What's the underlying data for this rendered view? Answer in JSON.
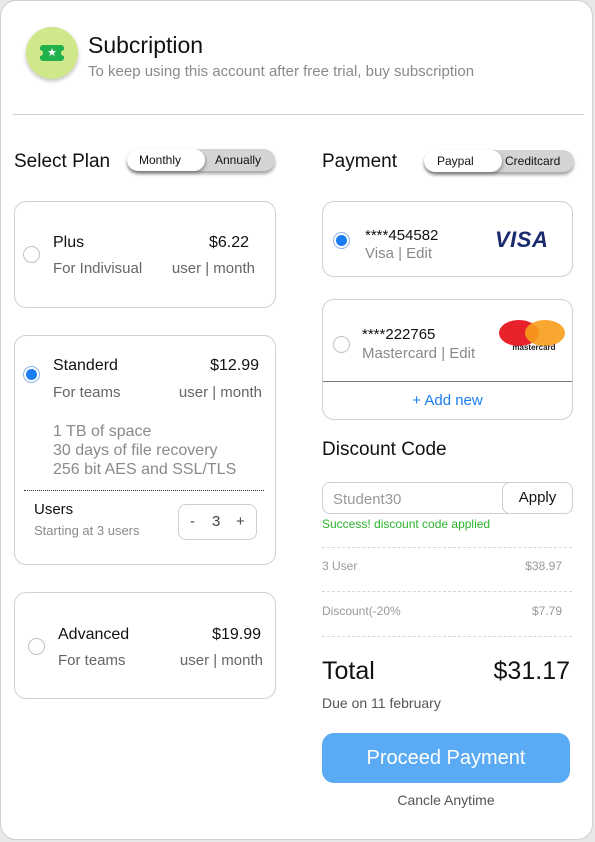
{
  "header": {
    "title": "Subcription",
    "subtitle": "To keep using this account after free trial, buy subscription"
  },
  "plans_section": {
    "heading": "Select Plan",
    "toggle": {
      "options": [
        "Monthly",
        "Annually"
      ],
      "selected": "Monthly"
    },
    "plans": [
      {
        "name": "Plus",
        "price": "$6.22",
        "audience": "For Indivisual",
        "unit": "user | month",
        "selected": false
      },
      {
        "name": "Standerd",
        "price": "$12.99",
        "audience": "For teams",
        "unit": "user | month",
        "selected": true,
        "features": [
          "1 TB of space",
          "30 days of file recovery",
          "256 bit AES and SSL/TLS"
        ],
        "users": {
          "label": "Users",
          "hint": "Starting at 3 users",
          "minus": "-",
          "value": "3",
          "plus": "+"
        }
      },
      {
        "name": "Advanced",
        "price": "$19.99",
        "audience": "For teams",
        "unit": "user | month",
        "selected": false
      }
    ]
  },
  "payment": {
    "heading": "Payment",
    "toggle": {
      "options": [
        "Paypal",
        "Creditcard"
      ],
      "selected": "Paypal"
    },
    "cards": [
      {
        "number": "****454582",
        "brand": "Visa",
        "edit": "Edit",
        "logo": "VISA",
        "selected": true
      },
      {
        "number": "****222765",
        "brand": "Mastercard",
        "edit": "Edit",
        "logo": "mastercard",
        "selected": false
      }
    ],
    "add_new": "+ Add new"
  },
  "discount": {
    "heading": "Discount Code",
    "value": "Student30",
    "apply": "Apply",
    "message": "Success! discount code applied"
  },
  "summary": {
    "rows": [
      {
        "label": "3 User",
        "amount": "$38.97"
      },
      {
        "label": "Discount(-20%",
        "amount": "$7.79"
      }
    ],
    "total_label": "Total",
    "total_amount": "$31.17",
    "due": "Due on 11 february"
  },
  "actions": {
    "proceed": "Proceed Payment",
    "cancel": "Cancle Anytime"
  },
  "colors": {
    "accent": "#1a7df2",
    "button": "#5aabf3",
    "success": "#2bb32b",
    "logo_bg": "#cfe88a",
    "logo_fg": "#22b14c"
  }
}
